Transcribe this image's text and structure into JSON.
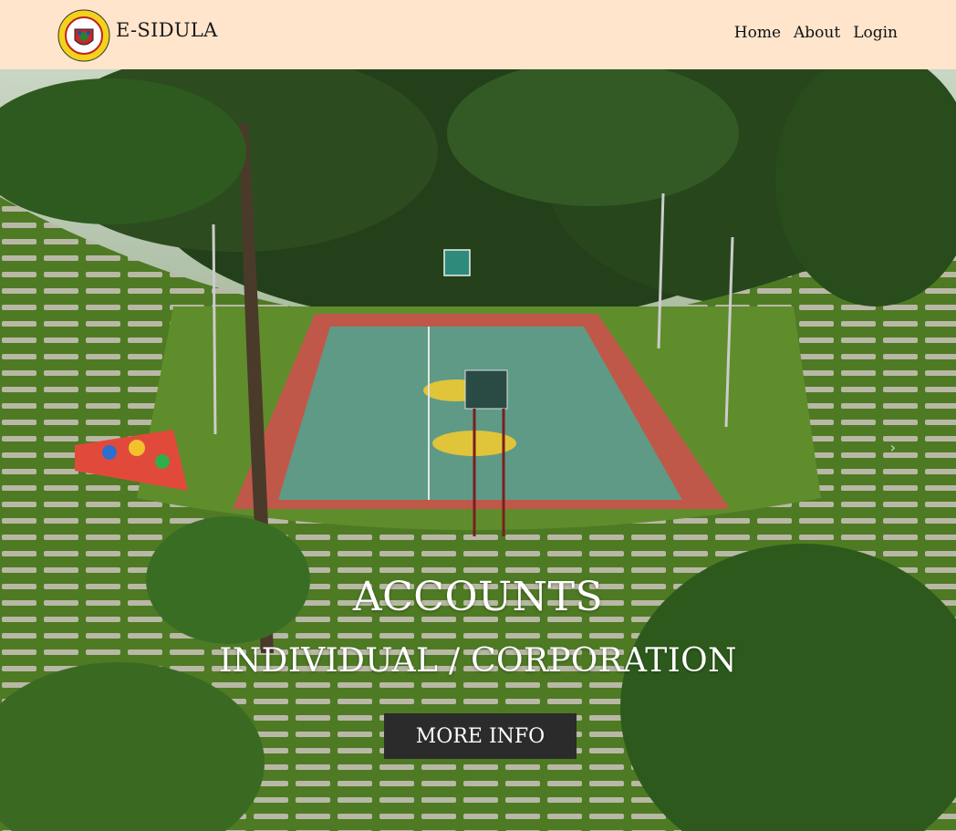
{
  "navbar": {
    "brand": "E-SIDULA",
    "logo_icon": "city-seal-icon",
    "links": [
      {
        "label": "Home"
      },
      {
        "label": "About"
      },
      {
        "label": "Login"
      }
    ]
  },
  "hero": {
    "title": "ACCOUNTS",
    "subtitle": "INDIVIDUAL / CORPORATION",
    "button_label": "MORE INFO",
    "next_icon": "chevron-right-icon",
    "next_glyph": "›"
  },
  "colors": {
    "navbar_bg": "#ffe5cc",
    "button_bg": "#2b2b2b",
    "text_light": "#ffffff"
  }
}
